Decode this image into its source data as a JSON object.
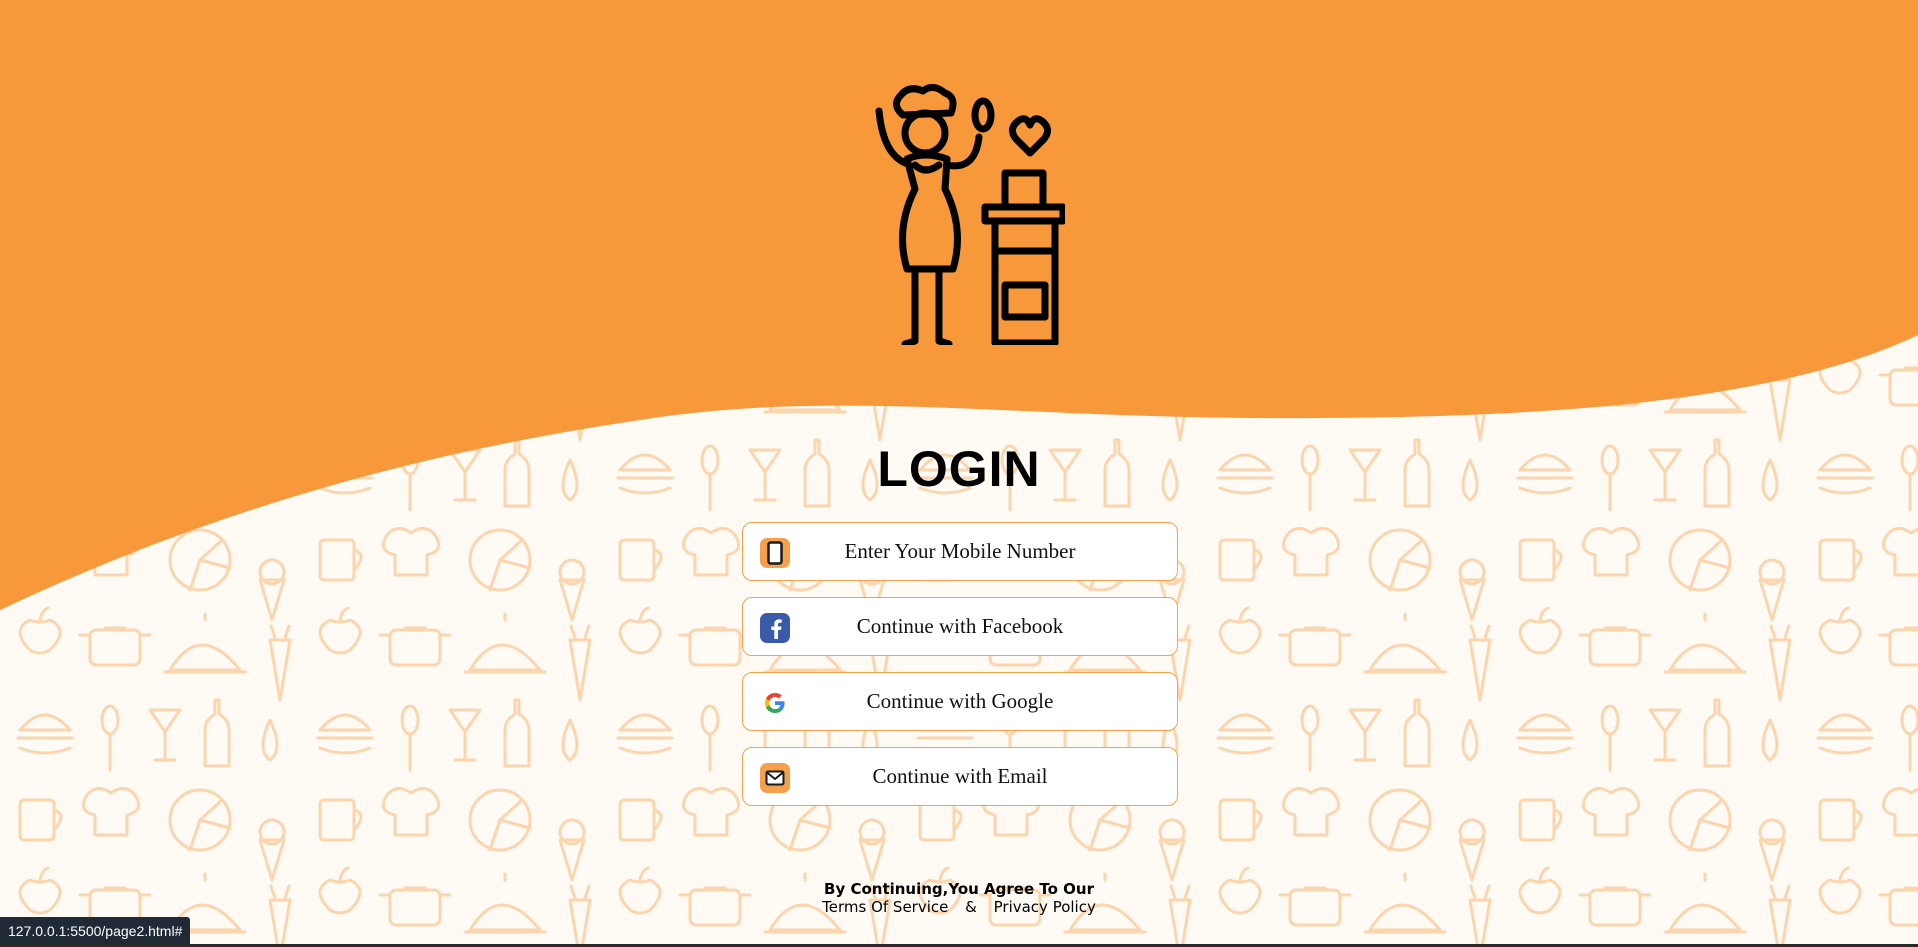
{
  "colors": {
    "accent": "#f7983a",
    "pattern": "#f8c58f",
    "background": "#fffaf4"
  },
  "hero_icon": "chef-cooking-icon",
  "title": "LOGIN",
  "buttons": [
    {
      "label": "Enter Your Mobile Number",
      "icon": "mobile-phone-icon"
    },
    {
      "label": "Continue with Facebook",
      "icon": "facebook-icon"
    },
    {
      "label": "Continue with Google",
      "icon": "google-icon"
    },
    {
      "label": "Continue with Email",
      "icon": "email-icon"
    }
  ],
  "footer": {
    "agree_text": "By Continuing,You Agree To Our",
    "terms": "Terms Of Service",
    "ampersand": "&",
    "privacy": "Privacy Policy"
  },
  "status_url": "127.0.0.1:5500/page2.html#"
}
